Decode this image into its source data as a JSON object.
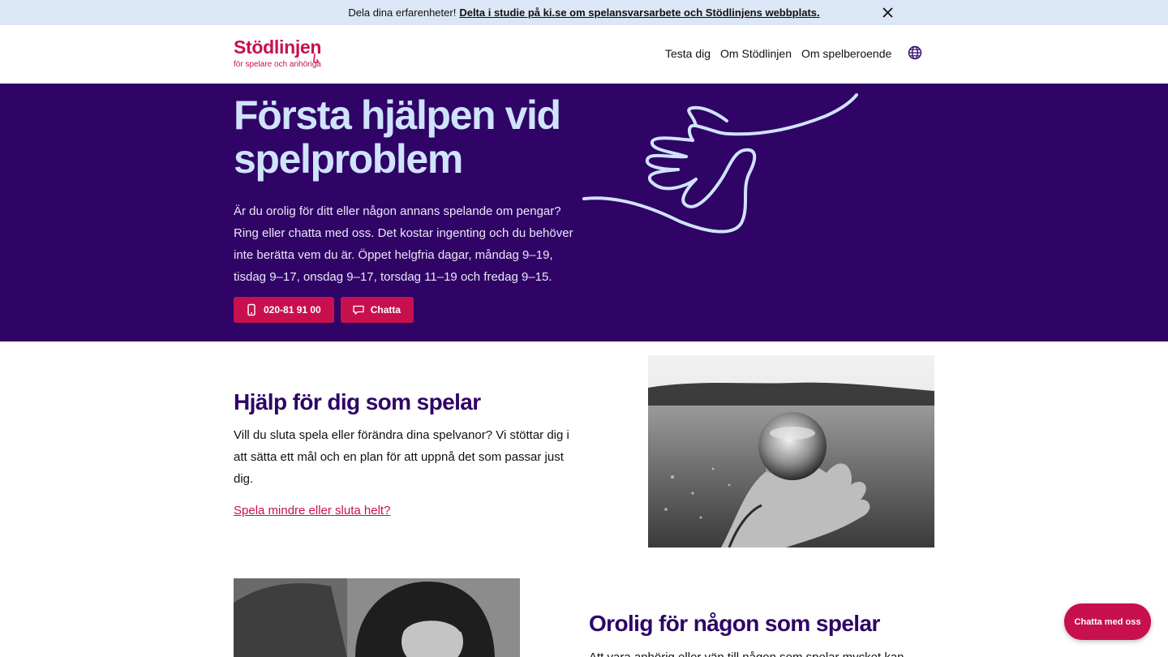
{
  "banner": {
    "prefix": "Dela dina erfarenheter!",
    "link": "Delta i studie på ki.se om spelansvarsarbete och Stödlinjens webbplats."
  },
  "header": {
    "logo_name": "Stödlinjen",
    "logo_tagline": "för spelare och anhöriga",
    "nav": [
      "Testa dig",
      "Om Stödlinjen",
      "Om spelberoende"
    ],
    "icons": {
      "language": "globe-icon",
      "close": "close-icon"
    }
  },
  "hero": {
    "title": "Första hjälpen vid spelproblem",
    "text": "Är du orolig för ditt eller någon annans spelande om pengar? Ring eller chatta med oss. Det kostar ingenting och du behöver inte berätta vem du är. Öppet helgfria dagar, måndag 9–19, tisdag 9–17, onsdag 9–17, torsdag 11–19 och fredag 9–15.",
    "phone_label": "020-81 91 00",
    "chat_label": "Chatta"
  },
  "section_player": {
    "title": "Hjälp för dig som spelar",
    "text": "Vill du sluta spela eller förändra dina spelvanor? Vi stöttar dig i att sätta ett mål och en plan för att uppnå det som passar just dig.",
    "link": "Spela mindre eller sluta helt?"
  },
  "section_relative": {
    "title": "Orolig för någon som spelar",
    "text": "Att vara anhörig eller vän till någon som spelar mycket kan"
  },
  "chat_fab": "Chatta med oss",
  "colors": {
    "brand": "#c8104e",
    "hero_bg": "#2f0466",
    "hero_title": "#cfe3fb",
    "banner_bg": "#dbe7f6"
  }
}
